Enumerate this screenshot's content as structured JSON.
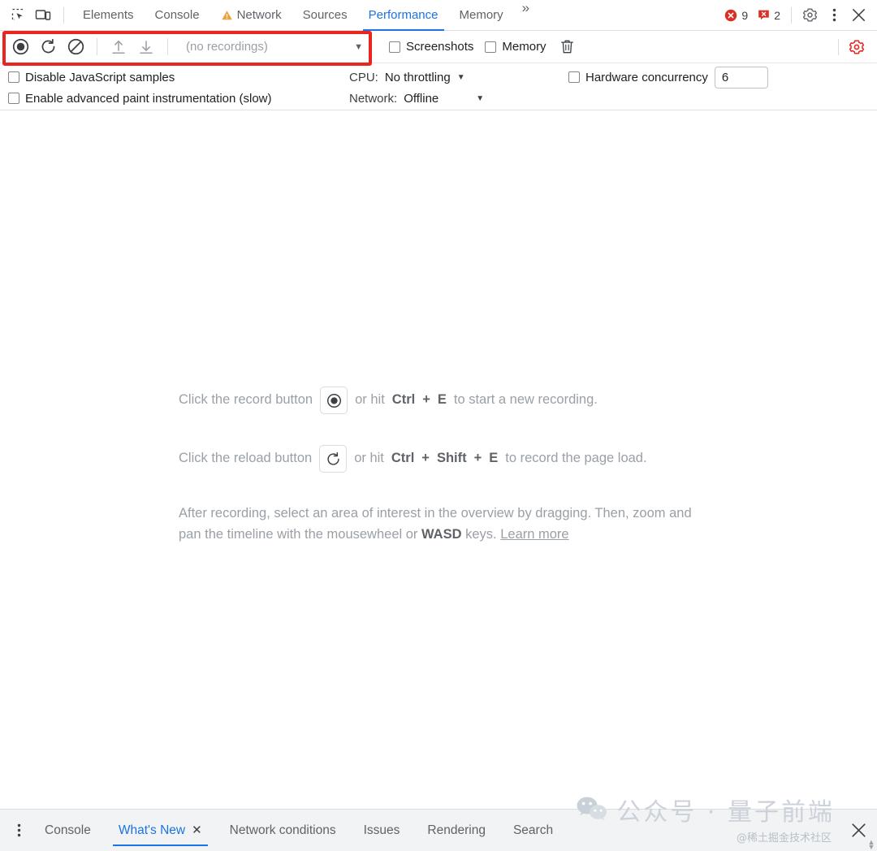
{
  "devtools": {
    "top_tabs": [
      {
        "label": "Elements",
        "active": false,
        "warning": false
      },
      {
        "label": "Console",
        "active": false,
        "warning": false
      },
      {
        "label": "Network",
        "active": false,
        "warning": true
      },
      {
        "label": "Sources",
        "active": false,
        "warning": false
      },
      {
        "label": "Performance",
        "active": true,
        "warning": false
      },
      {
        "label": "Memory",
        "active": false,
        "warning": false
      }
    ],
    "more_tabs_label": "»",
    "left_icons": [
      {
        "name": "inspect-element-icon"
      },
      {
        "name": "device-toolbar-icon"
      }
    ],
    "errors_count": "9",
    "issues_count": "2",
    "settings_icon": "gear-icon",
    "menu_icon": "dots-vertical-icon",
    "close_icon": "close-icon"
  },
  "toolbar": {
    "record_title": "record-button",
    "reload_title": "reload-and-record-button",
    "clear_title": "clear-button",
    "load_title": "load-profile-button",
    "save_title": "save-profile-button",
    "recordings_value": "(no recordings)",
    "recordings_caret": "▼",
    "screenshots_label": "Screenshots",
    "screenshots_checked": false,
    "memory_label": "Memory",
    "memory_checked": false,
    "delete_icon": "trash-icon",
    "capture_settings_icon": "gear-icon"
  },
  "settings": {
    "disable_js_samples_label": "Disable JavaScript samples",
    "disable_js_samples_checked": false,
    "advanced_paint_label": "Enable advanced paint instrumentation (slow)",
    "advanced_paint_checked": false,
    "cpu_label": "CPU:",
    "cpu_value": "No throttling",
    "network_label": "Network:",
    "network_value": "Offline",
    "caret": "▼",
    "hardware_concurrency_label": "Hardware concurrency",
    "hardware_concurrency_checked": false,
    "hardware_concurrency_value": "6"
  },
  "landing": {
    "record_prefix": "Click the record button",
    "record_suffix_a": "or hit",
    "record_key_1": "Ctrl",
    "record_plus": "+",
    "record_key_2": "E",
    "record_suffix_b": "to start a new recording.",
    "reload_prefix": "Click the reload button",
    "reload_suffix_a": "or hit",
    "reload_key_1": "Ctrl",
    "reload_key_2": "Shift",
    "reload_key_3": "E",
    "reload_suffix_b": "to record the page load.",
    "hint_part_1": "After recording, select an area of interest in the overview by dragging. Then, zoom and pan the timeline with the mousewheel or",
    "hint_keys": "WASD",
    "hint_part_2": "keys.",
    "learn_more": "Learn more"
  },
  "drawer": {
    "menu_icon": "dots-vertical-icon",
    "tabs": [
      {
        "label": "Console",
        "active": false,
        "closable": false
      },
      {
        "label": "What's New",
        "active": true,
        "closable": true
      },
      {
        "label": "Network conditions",
        "active": false,
        "closable": false
      },
      {
        "label": "Issues",
        "active": false,
        "closable": false
      },
      {
        "label": "Rendering",
        "active": false,
        "closable": false
      },
      {
        "label": "Search",
        "active": false,
        "closable": false
      }
    ],
    "close_icon": "close-icon",
    "close_label": "✕"
  },
  "watermark": {
    "logo": "wechat-logo",
    "main_text": "公众号 · 量子前端",
    "sub_text": "@稀土掘金技术社区"
  },
  "colors": {
    "accent_blue": "#1a73e8",
    "highlight_red": "#e8251f",
    "error_red": "#d93025",
    "warning_amber": "#e8a33d",
    "text_gray": "#5f6368",
    "muted_gray": "#9aa0a6"
  }
}
